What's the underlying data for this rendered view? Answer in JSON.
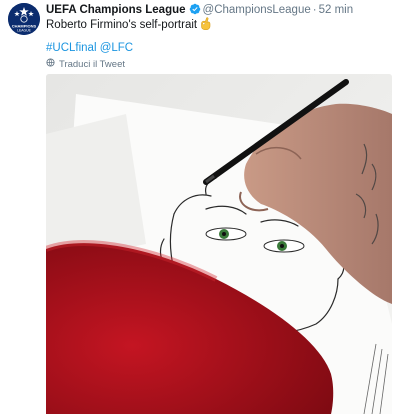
{
  "tweet": {
    "author_name": "UEFA Champions League",
    "author_handle": "@ChampionsLeague",
    "separator": "·",
    "time": "52 min",
    "text": "Roberto Firmino's self-portrait",
    "hashtag": "#UCLfinal",
    "mention": "@LFC",
    "translate_label": "Traduci il Tweet",
    "avatar_text": "CHAMPIONS\nLEAGUE",
    "verified": true
  },
  "icons": {
    "verified": "verified-badge-icon",
    "emoji": "ok-hand-emoji-icon",
    "translate": "globe-icon"
  },
  "colors": {
    "link": "#1b95e0",
    "muted": "#657786",
    "avatar_bg": "#0b2c6e",
    "jersey_red": "#b3101b"
  }
}
